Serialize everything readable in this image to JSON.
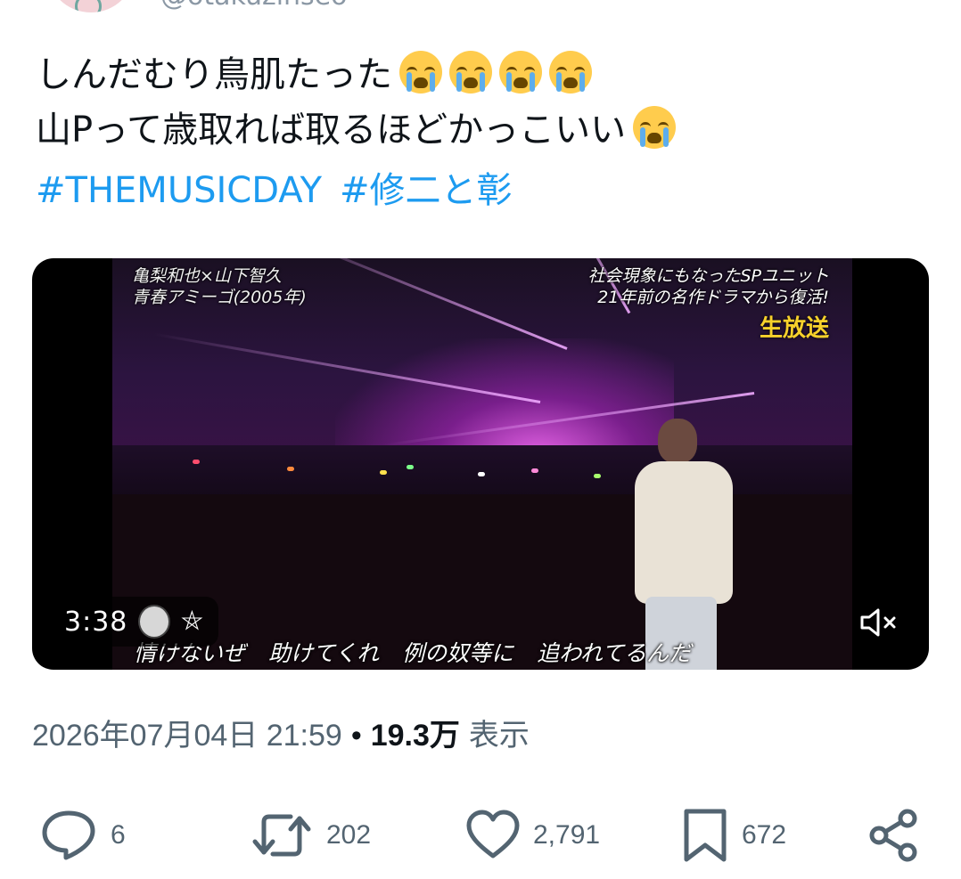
{
  "header": {
    "handle_partial": "@otakuzinseo"
  },
  "tweet": {
    "line1": "しんだむり鳥肌たった",
    "line2": "山Pって歳取れば取るほどかっこいい",
    "emojis": {
      "line1_count": 4,
      "line2_count": 1,
      "name": "loudly-crying-face-icon"
    },
    "hashtags": [
      "#THEMUSICDAY",
      "#修二と彰"
    ]
  },
  "video": {
    "caption_top_left_1": "亀梨和也×山下智久",
    "caption_top_left_2": "青春アミーゴ(2005年)",
    "caption_top_right_1": "社会現象にもなったSPユニット",
    "caption_top_right_2": "21年前の名作ドラマから復活!",
    "live_label": "生放送",
    "subtitle": "情けないぜ 助けてくれ 例の奴等に 追われてるんだ",
    "duration": "3:38",
    "muted": true
  },
  "meta": {
    "timestamp": "2026年07月04日 21:59",
    "separator": "•",
    "views": "19.3万",
    "views_label": "表示"
  },
  "actions": {
    "reply_count": "6",
    "retweet_count": "202",
    "like_count": "2,791",
    "bookmark_count": "672"
  },
  "colors": {
    "accent": "#1d9bf0",
    "secondary_text": "#536471",
    "live_label": "#f7d12b"
  }
}
